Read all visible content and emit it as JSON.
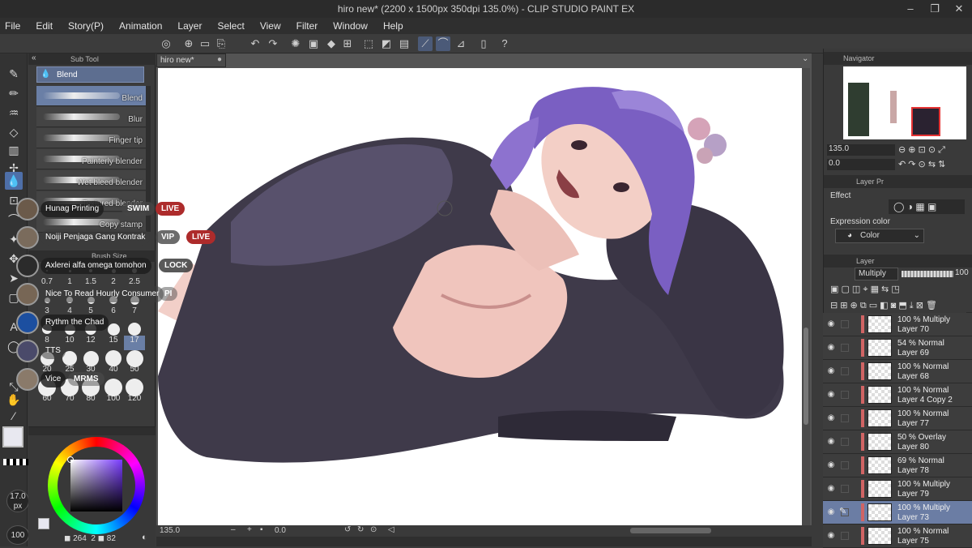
{
  "window": {
    "title": "hiro new* (2200 x 1500px 350dpi 135.0%) - CLIP STUDIO PAINT EX",
    "controls": [
      "–",
      "❐",
      "✕"
    ]
  },
  "menu": [
    "File",
    "Edit",
    "Story(P)",
    "Animation",
    "Layer",
    "Select",
    "View",
    "Filter",
    "Window",
    "Help"
  ],
  "subtool": {
    "tab_label": "Sub Tool",
    "group_label": "Blend",
    "brushes": [
      "Blend",
      "Blur",
      "Finger tip",
      "Painterly blender",
      "Wet bleed blender",
      "Textured blender",
      "Copy stamp"
    ],
    "brush_size_label": "Brush Size",
    "sizes": [
      "0.7",
      "1",
      "1.5",
      "2",
      "2.5",
      "3",
      "4",
      "5",
      "6",
      "7",
      "8",
      "10",
      "12",
      "15",
      "17",
      "20",
      "25",
      "30",
      "40",
      "50",
      "60",
      "70",
      "80",
      "100",
      "120"
    ],
    "selected_size": "17"
  },
  "tool_size": {
    "value": "17.0",
    "unit": "px"
  },
  "opacity_value": "100",
  "color_panel": {
    "stats": [
      "264",
      "2",
      "82"
    ]
  },
  "document": {
    "tab_label": "hiro new*",
    "zoom": "135.0",
    "angle": "0.0"
  },
  "navigator": {
    "tab_label": "Navigator",
    "zoom": "135.0",
    "angle": "0.0"
  },
  "layer_property": {
    "tab_label": "Layer Pr",
    "effect_label": "Effect",
    "expression_label": "Expression color",
    "expression_value": "Color"
  },
  "layer_panel": {
    "tab_label": "Layer",
    "blend_mode": "Multiply",
    "opacity": "100",
    "layers": [
      {
        "mode": "100 % Multiply",
        "name": "Layer 70",
        "sel": false
      },
      {
        "mode": "54 % Normal",
        "name": "Layer 69",
        "sel": false
      },
      {
        "mode": "100 % Normal",
        "name": "Layer 68",
        "sel": false
      },
      {
        "mode": "100 % Normal",
        "name": "Layer 4 Copy 2",
        "sel": false
      },
      {
        "mode": "100 % Normal",
        "name": "Layer 77",
        "sel": false
      },
      {
        "mode": "50 % Overlay",
        "name": "Layer 80",
        "sel": false
      },
      {
        "mode": "69 % Normal",
        "name": "Layer 78",
        "sel": false
      },
      {
        "mode": "100 % Multiply",
        "name": "Layer 79",
        "sel": false
      },
      {
        "mode": "100 % Multiply",
        "name": "Layer 73",
        "sel": true
      },
      {
        "mode": "100 % Normal",
        "name": "Layer 75",
        "sel": false
      }
    ]
  },
  "stream_overlay": {
    "rows": [
      {
        "user": "Hunag Printing",
        "badge": "SWIM",
        "tag": "LIVE"
      },
      {
        "user": "Noiji Penjaga Gang Kontrak",
        "badge": "VIP",
        "tag": "LIVE"
      },
      {
        "user": "Axlerei alfa omega tomohon",
        "badge": "",
        "tag": "LOCK"
      },
      {
        "user": "Nice To Read Hourly Consumer",
        "badge": "",
        "tag": "PI"
      },
      {
        "user": "Rythm the Chad",
        "badge": "",
        "tag": ""
      },
      {
        "user": "TTS",
        "badge": "",
        "tag": ""
      },
      {
        "user": "Vice",
        "badge": "",
        "tag": "MRMS"
      }
    ]
  },
  "colors": {
    "accent": "#4e6fa8",
    "selected_layer": "#6b7da4",
    "live_badge": "#ad2b2b"
  }
}
